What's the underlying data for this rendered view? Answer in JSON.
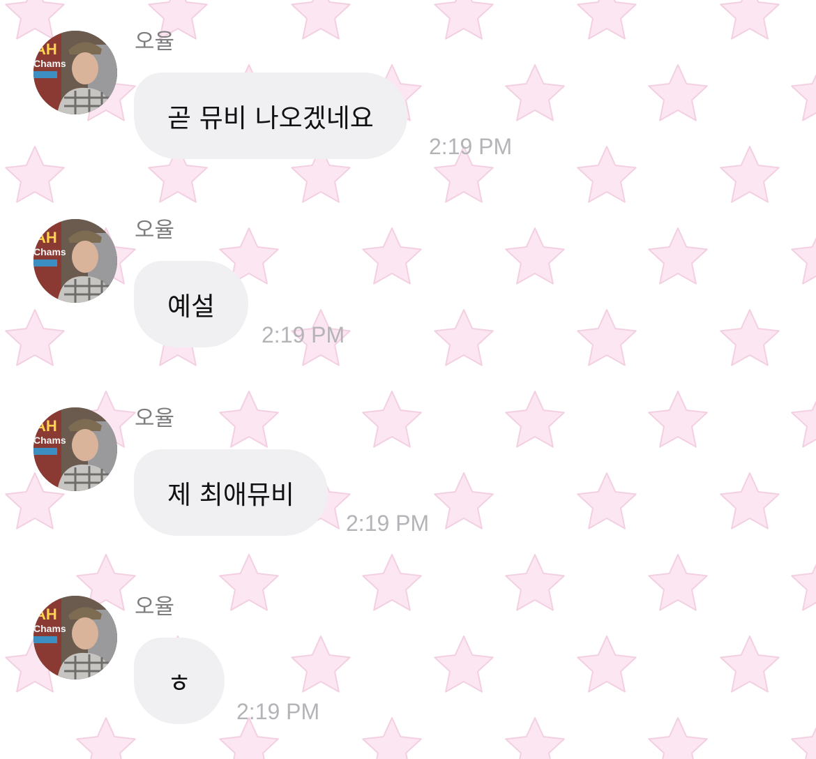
{
  "messages": [
    {
      "sender": "오율",
      "text": "곧 뮤비 나오겠네요",
      "time": "2:19 PM",
      "avatar": "profile-avatar"
    },
    {
      "sender": "오율",
      "text": "예설",
      "time": "2:19 PM",
      "avatar": "profile-avatar"
    },
    {
      "sender": "오율",
      "text": "제 최애뮤비",
      "time": "2:19 PM",
      "avatar": "profile-avatar"
    },
    {
      "sender": "오율",
      "text": "ㅎ",
      "time": "2:19 PM",
      "avatar": "profile-avatar"
    }
  ],
  "theme": {
    "background": "#ffffff",
    "pattern_icon": "star-icon",
    "pattern_color": "#fbe6f1",
    "pattern_stroke": "#f3cfe2",
    "bubble_color": "#f0f0f2",
    "time_color": "#b3b3b8",
    "sender_color": "#7d7d80"
  }
}
